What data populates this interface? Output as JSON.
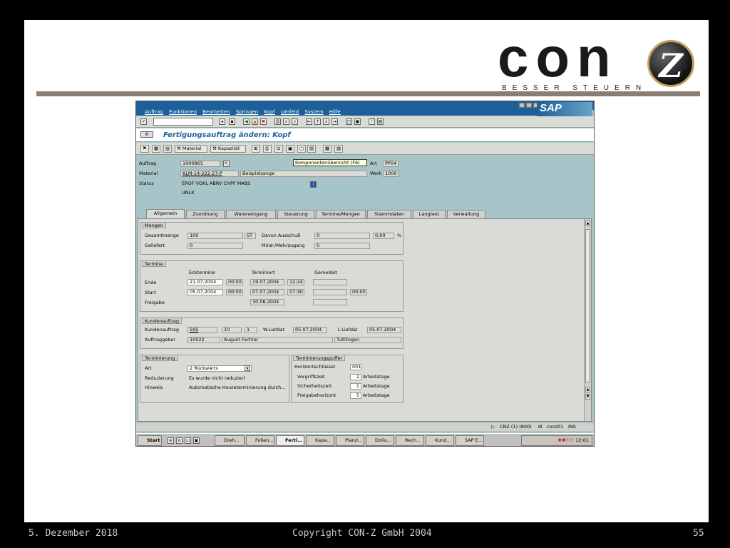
{
  "logo": {
    "text": "con",
    "badge": "Z",
    "tagline": "BESSER STEUERN"
  },
  "footer": {
    "date": "5. Dezember 2018",
    "copyright": "Copyright CON-Z GmbH 2004",
    "page": "55"
  },
  "sap": {
    "brand": "SAP",
    "menu": [
      "Auftrag",
      "Funktionen",
      "Bearbeiten",
      "Springen",
      "Kopf",
      "Umfeld",
      "System",
      "Hilfe"
    ],
    "title": "Fertigungsauftrag ändern: Kopf",
    "appbar": {
      "material": "Material",
      "kapazitaet": "Kapazität"
    },
    "tooltip": "Komponentenübersicht (F6)",
    "header": {
      "auftrag_label": "Auftrag",
      "auftrag": "1000865",
      "material_label": "Material",
      "material": "KLM-14-222-27-P",
      "material_text": "Beispielzange",
      "status_label": "Status",
      "status1": "EROF VOKL ABRV CHPF MABS",
      "status2": "UNLK",
      "art_label": "Art",
      "art": "PP04",
      "werk_label": "Werk",
      "werk": "1000"
    },
    "tabs": [
      "Allgemein",
      "Zuordnung",
      "Wareneingang",
      "Steuerung",
      "Termine/Mengen",
      "Stammdaten",
      "Langtext",
      "Verwaltung"
    ],
    "mengen": {
      "title": "Mengen",
      "gesamtmenge_label": "Gesamtmenge",
      "gesamtmenge": "100",
      "einheit": "ST",
      "ausschuss_label": "Davon Ausschuß",
      "ausschuss": "0",
      "ausschuss_pct": "0,00",
      "pct": "%",
      "geliefert_label": "Geliefert",
      "geliefert": "0",
      "mehr_label": "Mind-/Mehrzugang",
      "mehr": "0"
    },
    "termine": {
      "title": "Termine",
      "col_eck": "Ecktermine",
      "col_term": "Terminiert",
      "col_gem": "Gemeldet",
      "ende_label": "Ende",
      "ende_eck": "21.07.2004",
      "ende_eck_t": "00:00",
      "ende_term": "19.07.2004",
      "ende_term_t": "12:24",
      "start_label": "Start",
      "start_eck": "05.07.2004",
      "start_eck_t": "00:00",
      "start_term": "07.07.2004",
      "start_term_t": "07:30",
      "start_gem_t": "00:00",
      "freigabe_label": "Freigabe",
      "freigabe_term": "30.06.2004"
    },
    "kunde": {
      "title": "Kundenauftrag",
      "ka_label": "Kundenauftrag",
      "ka": "595",
      "pos": "10",
      "ein": "1",
      "wliefdat_label": "W.Liefdat",
      "wliefdat": "05.07.2004",
      "liefdat_label": "1.Liefdat",
      "liefdat": "05.07.2004",
      "ag_label": "Auftraggeber",
      "ag": "10022",
      "ag_name": "August Fechler",
      "ag_ort": "Tuttlingen"
    },
    "terminierung": {
      "title": "Terminierung",
      "art_label": "Art",
      "art": "2 Rückwärts",
      "red_label": "Reduzierung",
      "red": "Es wurde nicht reduziert",
      "hinweis_label": "Hinweis",
      "hinweis": "Automatische Heuteterminierung durch..."
    },
    "puffer": {
      "title": "Terminierungspuffer",
      "hs_label": "Horizontschlüssel",
      "hs": "001",
      "vor_label": "Vorgriffszeit",
      "vor": "2",
      "sich_label": "Sicherheitszeit",
      "sich": "1",
      "frei_label": "Freigabehorizont",
      "frei": "5",
      "unit": "Arbeitstage"
    },
    "status": {
      "system": "CNZ (1) (800)",
      "user": "conz01",
      "mode": "INS"
    },
    "taskbar": {
      "start": "Start",
      "items": [
        "Dreh...",
        "Folien...",
        "Ferti...",
        "Kapa...",
        "Plan/I...",
        "DolIu...",
        "Rech...",
        "Kund...",
        "SAP E..."
      ],
      "clock": "12:01"
    }
  }
}
